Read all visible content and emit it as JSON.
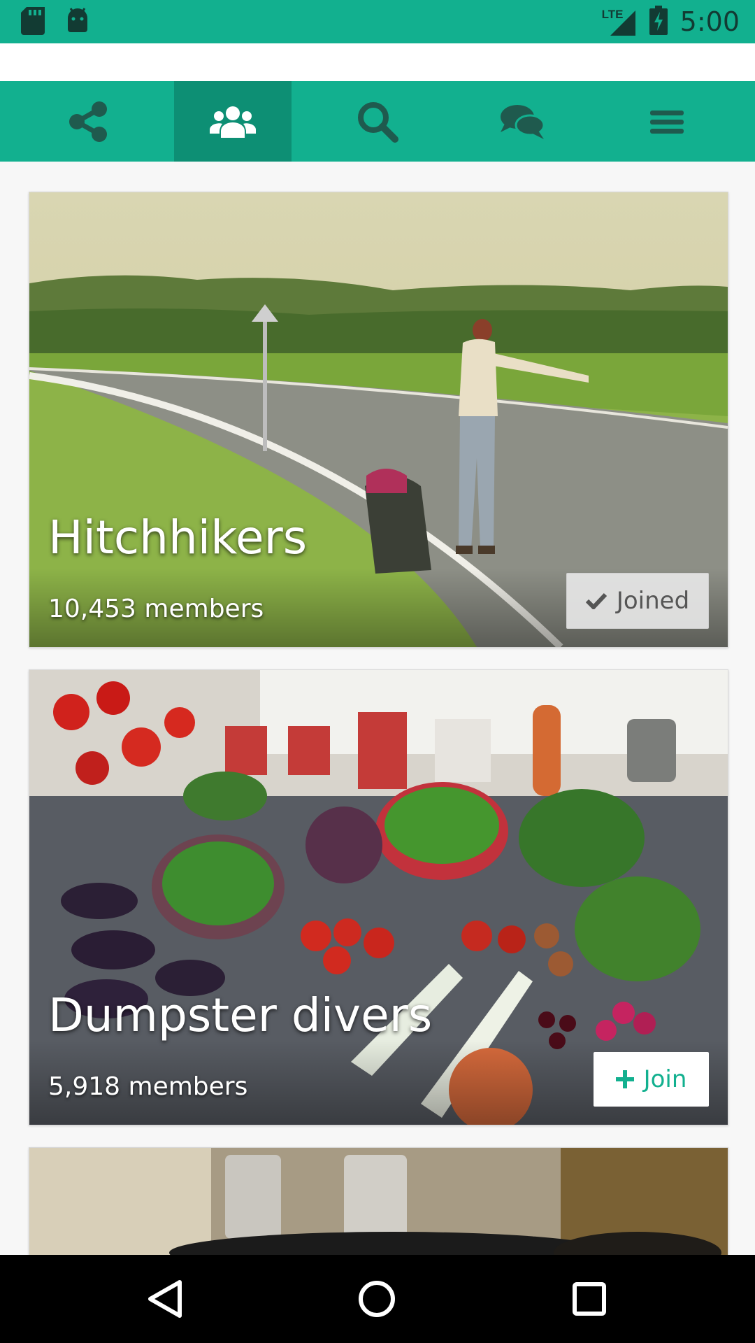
{
  "status_bar": {
    "network": "LTE",
    "time": "5:00"
  },
  "tabs": [
    {
      "name": "share",
      "icon": "share-icon",
      "active": false
    },
    {
      "name": "groups",
      "icon": "users-icon",
      "active": true
    },
    {
      "name": "search",
      "icon": "search-icon",
      "active": false
    },
    {
      "name": "messages",
      "icon": "chat-icon",
      "active": false
    },
    {
      "name": "menu",
      "icon": "hamburger-menu-icon",
      "active": false
    }
  ],
  "groups": [
    {
      "title": "Hitchhikers",
      "members": "10,453 members",
      "button_label": "Joined",
      "button_icon": "check-icon",
      "joined": true
    },
    {
      "title": "Dumpster divers",
      "members": "5,918 members",
      "button_label": "Join",
      "button_icon": "plus-icon",
      "joined": false
    }
  ],
  "colors": {
    "accent": "#12b08f",
    "accent_dark": "#0d8f74",
    "icon_dark": "#1f5a4e"
  }
}
